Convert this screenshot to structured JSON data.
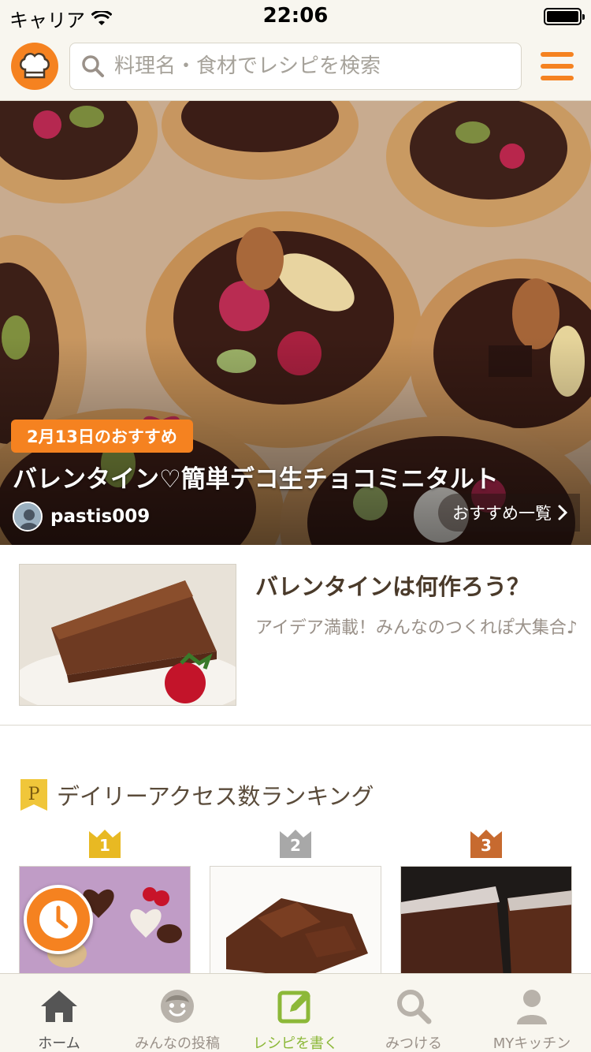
{
  "status_bar": {
    "carrier": "キャリア",
    "time": "22:06"
  },
  "header": {
    "logo_icon": "chef-hat-icon",
    "search_placeholder": "料理名・食材でレシピを検索",
    "menu_icon": "hamburger-menu-icon",
    "accent_color": "#f58220"
  },
  "hero": {
    "badge": "2月13日のおすすめ",
    "title": "バレンタイン♡簡単デコ生チョコミニタルト",
    "author": "pastis009",
    "more_label": "おすすめ一覧"
  },
  "feature": {
    "title": "バレンタインは何作ろう？",
    "description": "アイデア満載！みんなのつくれぽ大集合♪"
  },
  "ranking": {
    "title": "デイリーアクセス数ランキング",
    "badge_letter": "P",
    "items": [
      {
        "rank": "1",
        "crown_color": "#e8b923"
      },
      {
        "rank": "2",
        "crown_color": "#a8a8a8"
      },
      {
        "rank": "3",
        "crown_color": "#c76a2f"
      }
    ]
  },
  "tabbar": {
    "items": [
      {
        "label": "ホーム",
        "icon": "home-icon"
      },
      {
        "label": "みんなの投稿",
        "icon": "smile-face-icon"
      },
      {
        "label": "レシピを書く",
        "icon": "edit-note-icon"
      },
      {
        "label": "みつける",
        "icon": "search-icon"
      },
      {
        "label": "MYキッチン",
        "icon": "user-icon"
      }
    ]
  }
}
